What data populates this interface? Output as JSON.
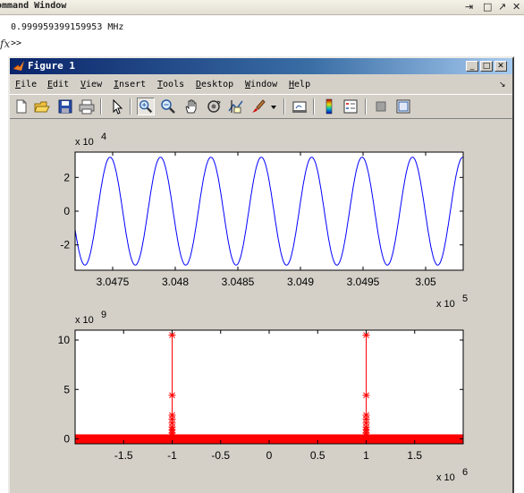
{
  "command_window": {
    "title": "ommand Window",
    "controls": [
      "⇥",
      "□",
      "↗",
      "✕"
    ],
    "output_line": "0.999959399159953 MHz",
    "prompt": ">>",
    "side_glyph": "fx"
  },
  "figure": {
    "title": "Figure 1",
    "title_controls": [
      "_",
      "□",
      "✕"
    ],
    "menu": [
      {
        "underline": "F",
        "rest": "ile"
      },
      {
        "underline": "E",
        "rest": "dit"
      },
      {
        "underline": "V",
        "rest": "iew"
      },
      {
        "underline": "I",
        "rest": "nsert"
      },
      {
        "underline": "T",
        "rest": "ools"
      },
      {
        "underline": "D",
        "rest": "esktop"
      },
      {
        "underline": "W",
        "rest": "indow"
      },
      {
        "underline": "H",
        "rest": "elp"
      }
    ],
    "menu_arrow": "↘",
    "toolbar_icons": [
      "new-figure-icon",
      "open-file-icon",
      "save-icon",
      "print-icon",
      "pointer-icon",
      "zoom-in-icon",
      "zoom-out-icon",
      "pan-hand-icon",
      "rotate-3d-icon",
      "data-cursor-icon",
      "brush-icon",
      "brush-dropdown-icon",
      "link-plot-icon",
      "colorbar-icon",
      "legend-icon",
      "hide-plot-tools-icon",
      "show-plot-tools-icon"
    ]
  },
  "chart_data": [
    {
      "type": "line",
      "title": "",
      "xlabel": "",
      "ylabel": "",
      "x_exponent_label": "x 10",
      "x_exponent": "5",
      "y_exponent_label": "x 10",
      "y_exponent": "4",
      "xlim": [
        3.0472,
        3.0503
      ],
      "ylim": [
        -3.5,
        3.5
      ],
      "xticks": [
        "3.0475",
        "3.048",
        "3.0485",
        "3.049",
        "3.0495",
        "3.05"
      ],
      "xtick_values": [
        3.0475,
        3.048,
        3.0485,
        3.049,
        3.0495,
        3.05
      ],
      "yticks": [
        "-2",
        "0",
        "2"
      ],
      "ytick_values": [
        -2,
        0,
        2
      ],
      "series": [
        {
          "color": "#0000ff",
          "amplitude": 3.2,
          "cycles": 7.7,
          "phase_deg": 200
        }
      ],
      "grid": false
    },
    {
      "type": "line",
      "title": "",
      "xlabel": "",
      "ylabel": "",
      "x_exponent_label": "x 10",
      "x_exponent": "6",
      "y_exponent_label": "x 10",
      "y_exponent": "9",
      "xlim": [
        -2,
        2
      ],
      "ylim": [
        -0.5,
        11
      ],
      "xticks": [
        "-1.5",
        "-1",
        "-0.5",
        "0",
        "0.5",
        "1",
        "1.5"
      ],
      "xtick_values": [
        -1.5,
        -1,
        -0.5,
        0,
        0.5,
        1,
        1.5
      ],
      "yticks": [
        "0",
        "5",
        "10"
      ],
      "ytick_values": [
        0,
        5,
        10
      ],
      "series": [
        {
          "color": "#ff0000",
          "marker": "*",
          "peaks": [
            {
              "x": -1,
              "y": 10.5
            },
            {
              "x": 1,
              "y": 10.5
            }
          ],
          "baseline": 0
        }
      ],
      "grid": false
    }
  ]
}
